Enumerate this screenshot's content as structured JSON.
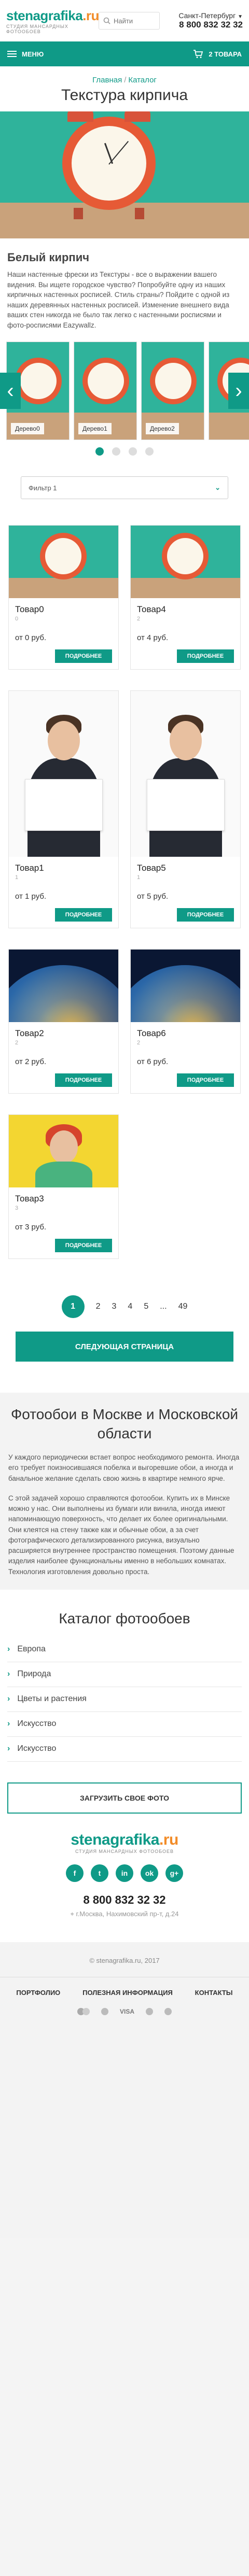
{
  "header": {
    "logo_main": "stenagrafika",
    "logo_tld": ".ru",
    "logo_sub": "студия мансардных фотообоев",
    "search_placeholder": "Найти",
    "city": "Санкт-Петербург",
    "phone": "8 800 832 32 32"
  },
  "topbar": {
    "menu_label": "МЕНЮ",
    "cart_label": "2 ТОВАРА"
  },
  "breadcrumb": {
    "home": "Главная",
    "sep": "/",
    "catalog": "Каталог"
  },
  "page_title": "Текстура кирпича",
  "section_title": "Белый кирпич",
  "description": "Наши настенные фрески из Текстуры - все о выражении вашего видения. Вы ищете городское чувство? Попробуйте одну из наших кирпичных настенных росписей. Стиль страны? Пойдите с одной из наших деревянных настенных росписей. Изменение внешнего вида ваших стен никогда не было так легко с настенными росписями и фото-росписями Eazywallz.",
  "slider": {
    "slides": [
      {
        "label": "Дерево0"
      },
      {
        "label": "Дерево1"
      },
      {
        "label": "Дерево2"
      }
    ]
  },
  "filter": {
    "label": "Фильтр 1"
  },
  "products": [
    {
      "title": "Товар0",
      "code": "0",
      "price": "от 0 руб.",
      "button": "ПОДРОБНЕЕ",
      "image": "clock"
    },
    {
      "title": "Товар4",
      "code": "2",
      "price": "от 4 руб.",
      "button": "ПОДРОБНЕЕ",
      "image": "clock"
    },
    {
      "title": "Товар1",
      "code": "1",
      "price": "от 1 руб.",
      "button": "ПОДРОБНЕЕ",
      "image": "person"
    },
    {
      "title": "Товар5",
      "code": "1",
      "price": "от 5 руб.",
      "button": "ПОДРОБНЕЕ",
      "image": "person"
    },
    {
      "title": "Товар2",
      "code": "2",
      "price": "от 2 руб.",
      "button": "ПОДРОБНЕЕ",
      "image": "globe"
    },
    {
      "title": "Товар6",
      "code": "2",
      "price": "от 6 руб.",
      "button": "ПОДРОБНЕЕ",
      "image": "globe"
    },
    {
      "title": "Товар3",
      "code": "3",
      "price": "от 3 руб.",
      "button": "ПОДРОБНЕЕ",
      "image": "pinup"
    }
  ],
  "pagination": {
    "pages": [
      "1",
      "2",
      "3",
      "4",
      "5",
      "...",
      "49"
    ],
    "active": "1",
    "next_label": "СЛЕДУЮЩАЯ СТРАНИЦА"
  },
  "seo": {
    "title": "Фотообои в Москве и Московской области",
    "p1": "У каждого периодически встает вопрос необходимого ремонта. Иногда его требует поизносившаяся побелка и выгоревшие обои, а иногда и банальное желание сделать свою жизнь в квартире немного ярче.",
    "p2": "С этой задачей хорошо справляются фотообои. Купить их в Минске можно у нас. Они выполнены из бумаги или винила, иногда имеют напоминающую поверхность, что делает их более оригинальными. Они клеятся на стену также как и обычные обои, а за счет фотографического детализированного рисунка, визуально расширяется внутреннее пространство помещения. Поэтому данные изделия наиболее функциональны именно в небольших комнатах. Технология изготовления довольно проста."
  },
  "catalog": {
    "title": "Каталог фотообоев",
    "items": [
      "Европа",
      "Природа",
      "Цветы и растения",
      "Искусство",
      "Искусство"
    ]
  },
  "upload_label": "ЗАГРУЗИТЬ СВОЕ ФОТО",
  "footer": {
    "phone": "8 800 832 32 32",
    "address": "г.Москва, Нахимовский пр-т, д.24",
    "copyright": "© stenagrafika.ru, 2017",
    "nav": [
      "ПОРТФОЛИО",
      "ПОЛЕЗНАЯ ИНФОРМАЦИЯ",
      "КОНТАКТЫ"
    ],
    "payments": [
      "VISA"
    ],
    "socials": [
      "f",
      "t",
      "in",
      "ok",
      "g+"
    ]
  },
  "colors": {
    "accent": "#0f9a87",
    "logo_dot": "#f28c28"
  }
}
